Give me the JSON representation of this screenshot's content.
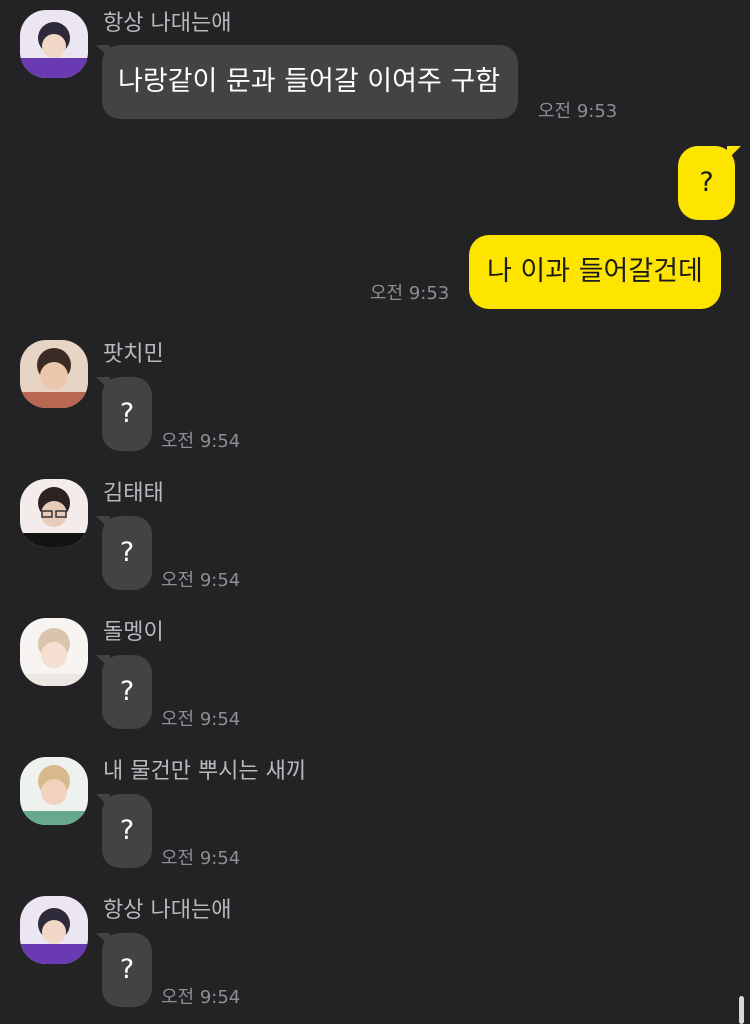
{
  "messages": [
    {
      "sender": "항상 나대는애",
      "text": "나랑같이 문과 들어갈 이여주 구함",
      "time": "오전 9:53"
    },
    {
      "sender": "me",
      "text": "?",
      "time": ""
    },
    {
      "sender": "me",
      "text": "나 이과 들어갈건데",
      "time": "오전 9:53"
    },
    {
      "sender": "팟치민",
      "text": "?",
      "time": "오전 9:54"
    },
    {
      "sender": "김태태",
      "text": "?",
      "time": "오전 9:54"
    },
    {
      "sender": "돌멩이",
      "text": "?",
      "time": "오전 9:54"
    },
    {
      "sender": "내 물건만 뿌시는 새끼",
      "text": "?",
      "time": "오전 9:54"
    },
    {
      "sender": "항상 나대는애",
      "text": "?",
      "time": "오전 9:54"
    }
  ],
  "colors": {
    "background": "#232325",
    "incoming_bubble": "#434346",
    "outgoing_bubble": "#fee500",
    "name_text": "#b9b9bd",
    "time_text": "#8e8e93"
  },
  "icons": {
    "avatar": "profile-photo"
  }
}
